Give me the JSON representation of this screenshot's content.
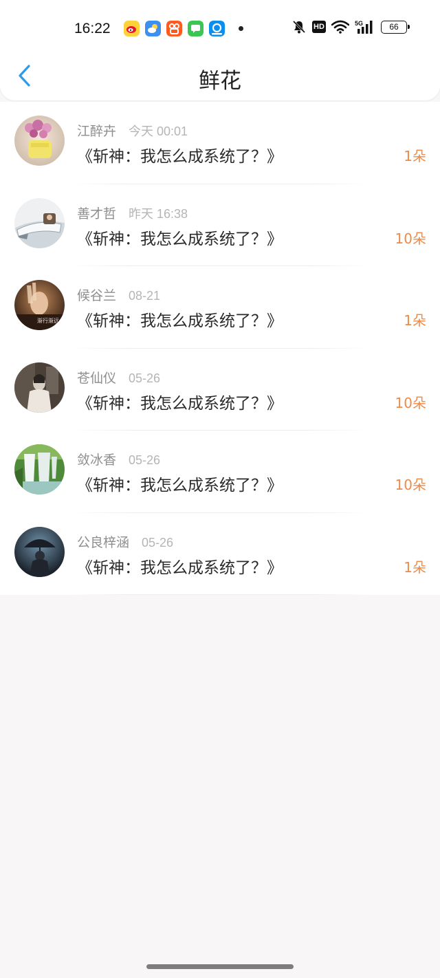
{
  "status_bar": {
    "time": "16:22",
    "apps": [
      "weibo-app-icon",
      "weather-app-icon",
      "kuaishou-app-icon",
      "messages-app-icon",
      "eleme-app-icon"
    ],
    "system_icons": [
      "mute-icon",
      "hd-icon",
      "wifi-icon",
      "5g-signal-icon",
      "battery-icon"
    ],
    "hd": "HD",
    "network": "5G",
    "battery": "66"
  },
  "header": {
    "back_icon": "chevron-left-icon",
    "title": "鲜花"
  },
  "list": [
    {
      "name": "江醉卉",
      "time": "今天 00:01",
      "book": "《斩神：我怎么成系统了？》",
      "count": "1朵"
    },
    {
      "name": "善才哲",
      "time": "昨天 16:38",
      "book": "《斩神：我怎么成系统了？》",
      "count": "10朵"
    },
    {
      "name": "候谷兰",
      "time": "08-21",
      "book": "《斩神：我怎么成系统了？》",
      "count": "1朵",
      "avatar_caption": "渐行渐远"
    },
    {
      "name": "苍仙仪",
      "time": "05-26",
      "book": "《斩神：我怎么成系统了？》",
      "count": "10朵"
    },
    {
      "name": "敛冰香",
      "time": "05-26",
      "book": "《斩神：我怎么成系统了？》",
      "count": "10朵"
    },
    {
      "name": "公良梓涵",
      "time": "05-26",
      "book": "《斩神：我怎么成系统了？》",
      "count": "1朵"
    }
  ],
  "colors": {
    "accent": "#2c9be8",
    "flower_count": "#ef8a46",
    "background": "#f8f6f7"
  }
}
